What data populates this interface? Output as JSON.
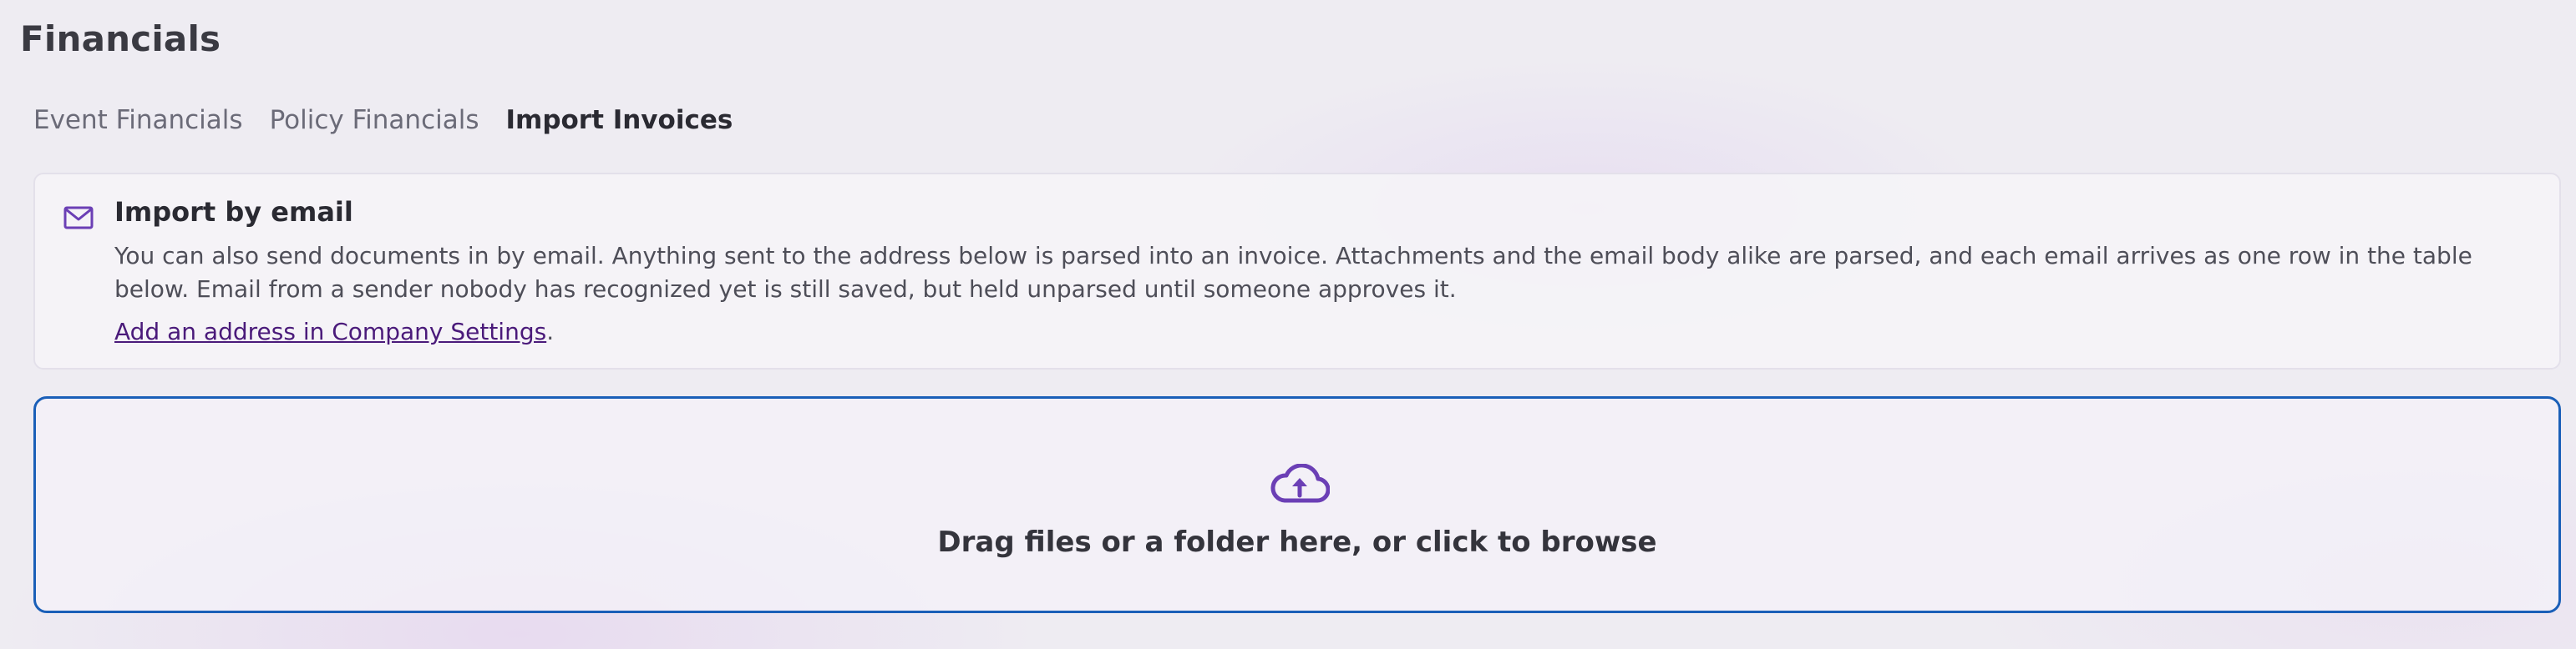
{
  "page": {
    "title": "Financials"
  },
  "tabs": [
    {
      "label": "Event Financials",
      "active": false
    },
    {
      "label": "Policy Financials",
      "active": false
    },
    {
      "label": "Import Invoices",
      "active": true
    }
  ],
  "email_import": {
    "icon": "mail-icon",
    "title": "Import by email",
    "description": "You can also send documents in by email. Anything sent to the address below is parsed into an invoice. Attachments and the email body alike are parsed, and each email arrives as one row in the table below. Email from a sender nobody has recognized yet is still saved, but held unparsed until someone approves it.",
    "link_label": "Add an address in Company Settings",
    "link_suffix": "."
  },
  "dropzone": {
    "icon": "cloud-upload-icon",
    "label": "Drag files or a folder here, or click to browse"
  },
  "colors": {
    "accent": "#6b3fb5",
    "dropzone_border": "#1a5fb8",
    "link": "#4a1a7a"
  }
}
